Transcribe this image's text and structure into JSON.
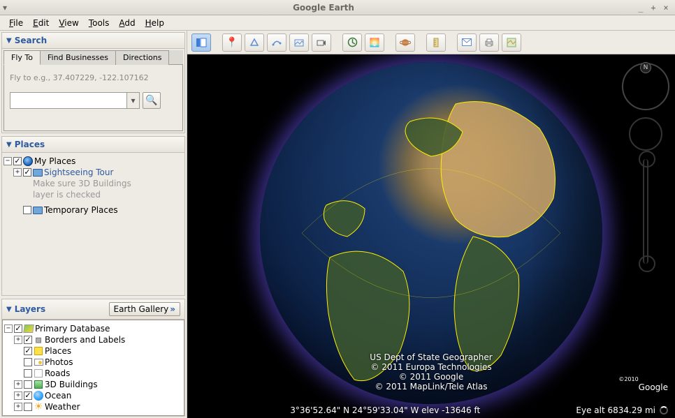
{
  "window": {
    "title": "Google Earth"
  },
  "menu": {
    "file": "File",
    "edit": "Edit",
    "view": "View",
    "tools": "Tools",
    "add": "Add",
    "help": "Help"
  },
  "search": {
    "header": "Search",
    "tabs": {
      "flyto": "Fly To",
      "businesses": "Find Businesses",
      "directions": "Directions"
    },
    "hint": "Fly to e.g., 37.407229, -122.107162",
    "input_value": ""
  },
  "places": {
    "header": "Places",
    "my_places": "My Places",
    "sightseeing": "Sightseeing Tour",
    "sightseeing_hint1": "Make sure 3D Buildings",
    "sightseeing_hint2": "layer is checked",
    "temporary": "Temporary Places"
  },
  "layers": {
    "header": "Layers",
    "gallery_btn": "Earth Gallery",
    "primary": "Primary Database",
    "borders": "Borders and Labels",
    "places": "Places",
    "photos": "Photos",
    "roads": "Roads",
    "buildings": "3D Buildings",
    "ocean": "Ocean",
    "weather": "Weather"
  },
  "attribution": {
    "line1": "US Dept of State Geographer",
    "line2": "© 2011 Europa Technologies",
    "line3": "© 2011 Google",
    "line4": "© 2011 MapLink/Tele Atlas"
  },
  "status": {
    "coords": "3°36'52.64\" N   24°59'33.04\" W  elev -13646 ft",
    "eye": "Eye alt  6834.29 mi"
  },
  "logo": {
    "year": "©2010",
    "brand": "Google"
  }
}
